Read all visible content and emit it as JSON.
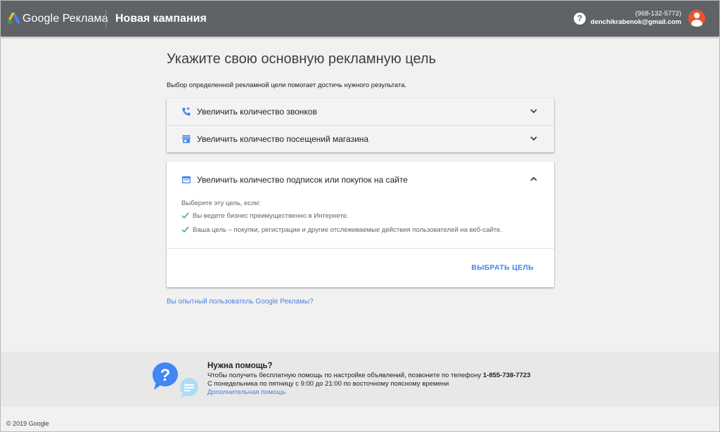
{
  "header": {
    "brand": "Google Реклама",
    "campaign_title": "Новая кампания",
    "help_glyph": "?",
    "phone": "(968-132-5772)",
    "email": "denchikrabenok@gmail.com"
  },
  "main": {
    "title": "Укажите свою основную рекламную цель",
    "subtitle": "Выбор определенной рекламной цели помогает достичь нужного результата.",
    "goals": [
      {
        "label": "Увеличить количество звонков",
        "icon": "phone-calls-icon",
        "expanded": false
      },
      {
        "label": "Увеличить количество посещений магазина",
        "icon": "store-icon",
        "expanded": false
      },
      {
        "label": "Увеличить количество подписок или покупок на сайте",
        "icon": "web-page-icon",
        "expanded": true,
        "choose_text": "Выберите эту цель, если:",
        "reasons": [
          "Вы ведете бизнес преимущественно в Интернете.",
          "Ваша цель – покупки, регистрации и другие отслеживаемые действия пользователей на веб-сайте."
        ],
        "select_label": "ВЫБРАТЬ ЦЕЛЬ"
      }
    ],
    "expert_link": "Вы опытный пользователь Google Рекламы?"
  },
  "help": {
    "title": "Нужна помощь?",
    "line1_text": "Чтобы получить бесплатную помощь по настройке объявлений, позвоните по телефону ",
    "line1_phone": "1-855-738-7723",
    "line2": "С понедельника по пятницу с 9:00 до 21:00 по восточному поясному времени",
    "more_link": "Дополнительная помощь"
  },
  "footer": {
    "copyright": "© 2019 Google"
  },
  "colors": {
    "accent": "#4285f4",
    "header_bg": "#5f6368",
    "check": "#34a853",
    "avatar": "#e8552d"
  }
}
